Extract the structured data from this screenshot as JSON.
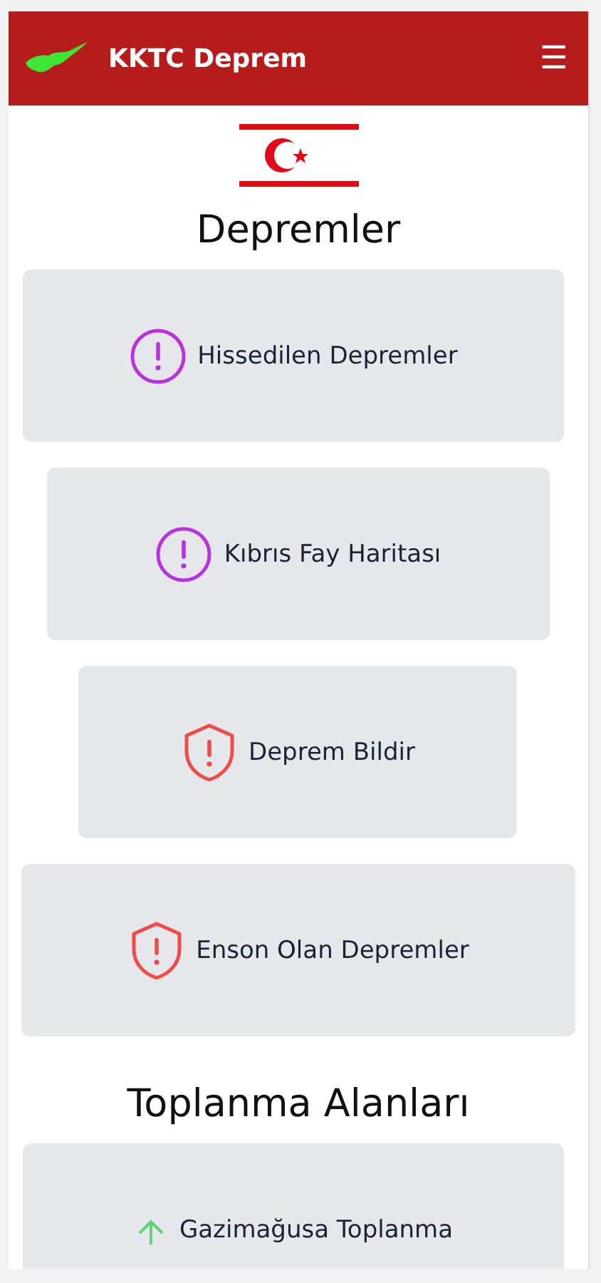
{
  "navbar": {
    "title": "KKTC Deprem",
    "menu_icon": "☰"
  },
  "sections": [
    {
      "heading": "Depremler",
      "cards": [
        {
          "label": "Hissedilen Depremler",
          "kind": "alert"
        },
        {
          "label": "Kıbrıs Fay Haritası",
          "kind": "alert"
        },
        {
          "label": "Deprem Bildir",
          "kind": "shield"
        },
        {
          "label": "Enson Olan Depremler",
          "kind": "shield"
        }
      ]
    },
    {
      "heading": "Toplanma Alanları",
      "cards": [
        {
          "label": "Gazimağusa Toplanma",
          "kind": "arrow"
        }
      ]
    }
  ]
}
